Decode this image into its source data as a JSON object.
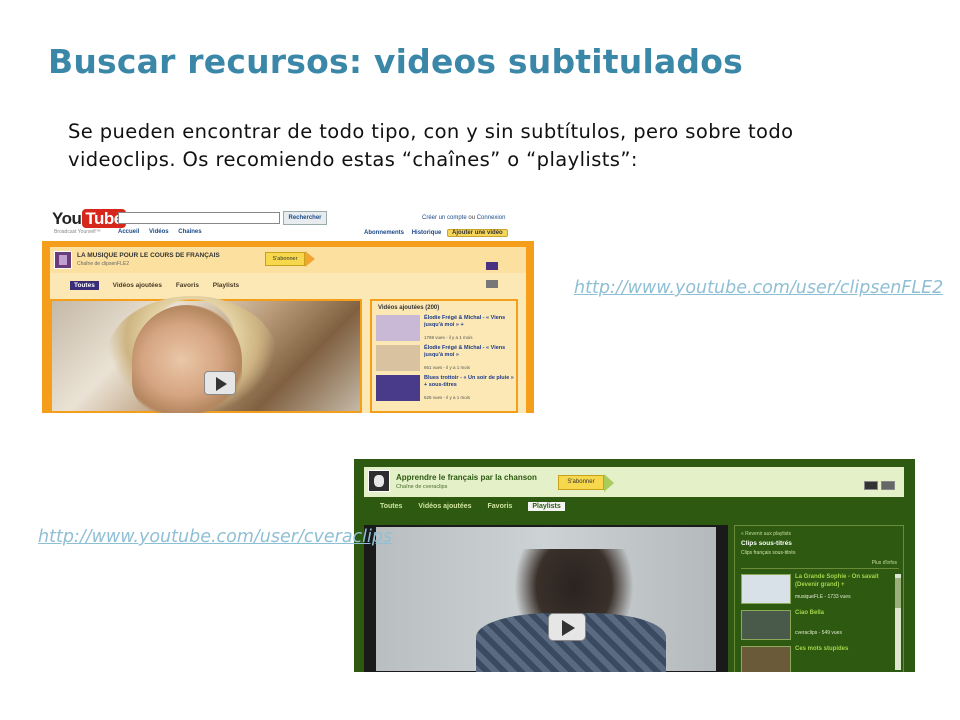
{
  "slide": {
    "title": "Buscar recursos: videos subtitulados",
    "body": "Se pueden encontrar de todo tipo, con y sin subtítulos, pero sobre todo videoclips. Os recomiendo estas “chaînes” o “playlists”:",
    "link1": "http://www.youtube.com/user/clipsenFLE2",
    "link2": "http://www.youtube.com/user/cveraclips"
  },
  "shot1": {
    "logo_you": "You",
    "logo_tube": "Tube",
    "slogan": "Broadcast Yourself™",
    "search_button": "Rechercher",
    "create_account": "Créer un compte",
    "or": "ou",
    "login": "Connexion",
    "nav": [
      "Accueil",
      "Vidéos",
      "Chaînes"
    ],
    "subscriptions": "Abonnements",
    "history": "Historique",
    "upload": "Ajouter une vidéo",
    "channel_title": "LA MUSIQUE POUR LE COURS DE FRANÇAIS",
    "channel_sub": "Chaîne de clipsenFLE2",
    "subscribe": "S'abonner",
    "tabs": [
      "Toutes",
      "Vidéos ajoutées",
      "Favoris",
      "Playlists"
    ],
    "sidebar_heading": "Vidéos ajoutées (200)",
    "items": [
      {
        "title": "Élodie Frégé & Michal - « Viens jusqu'à moi » +",
        "meta": "1769 vues - il y a 1 mois",
        "thumb_color": "#c9b8d6"
      },
      {
        "title": "Élodie Frégé & Michal - « Viens jusqu'à moi »",
        "meta": "661 vues - il y a 1 mois",
        "thumb_color": "#d9c2a0"
      },
      {
        "title": "Blues trottoir - « Un soir de pluie » + sous-titres",
        "meta": "626 vues - il y a 1 mois",
        "thumb_color": "#4a3a8a"
      }
    ]
  },
  "shot2": {
    "channel_title": "Apprendre le français par la chanson",
    "channel_sub": "Chaîne de cveraclips",
    "subscribe": "S'abonner",
    "tabs": [
      "Toutes",
      "Vidéos ajoutées",
      "Favoris",
      "Playlists"
    ],
    "back": "« Revenir aux playlists",
    "playlist_title": "Clips sous-titrés",
    "playlist_sub": "Clips français sous-titrés",
    "more": "Plus d'infos",
    "items": [
      {
        "title": "La Grande Sophie - On savait (Devenir grand) +",
        "meta": "musiqueFLE - 1733 vues",
        "thumb_color": "#d8e0e8"
      },
      {
        "title": "Ciao Bella",
        "meta": "cveraclips - 549 vues",
        "thumb_color": "#4a5a4a"
      },
      {
        "title": "Ces mots stupides",
        "meta": "",
        "thumb_color": "#6a5a3a"
      }
    ],
    "colors": {
      "background": "#2d5a10",
      "accent": "#a6d44a"
    }
  },
  "colors": {
    "title": "#3a87a8",
    "link": "#8fbfd4",
    "yt_orange": "#f59e1c"
  }
}
